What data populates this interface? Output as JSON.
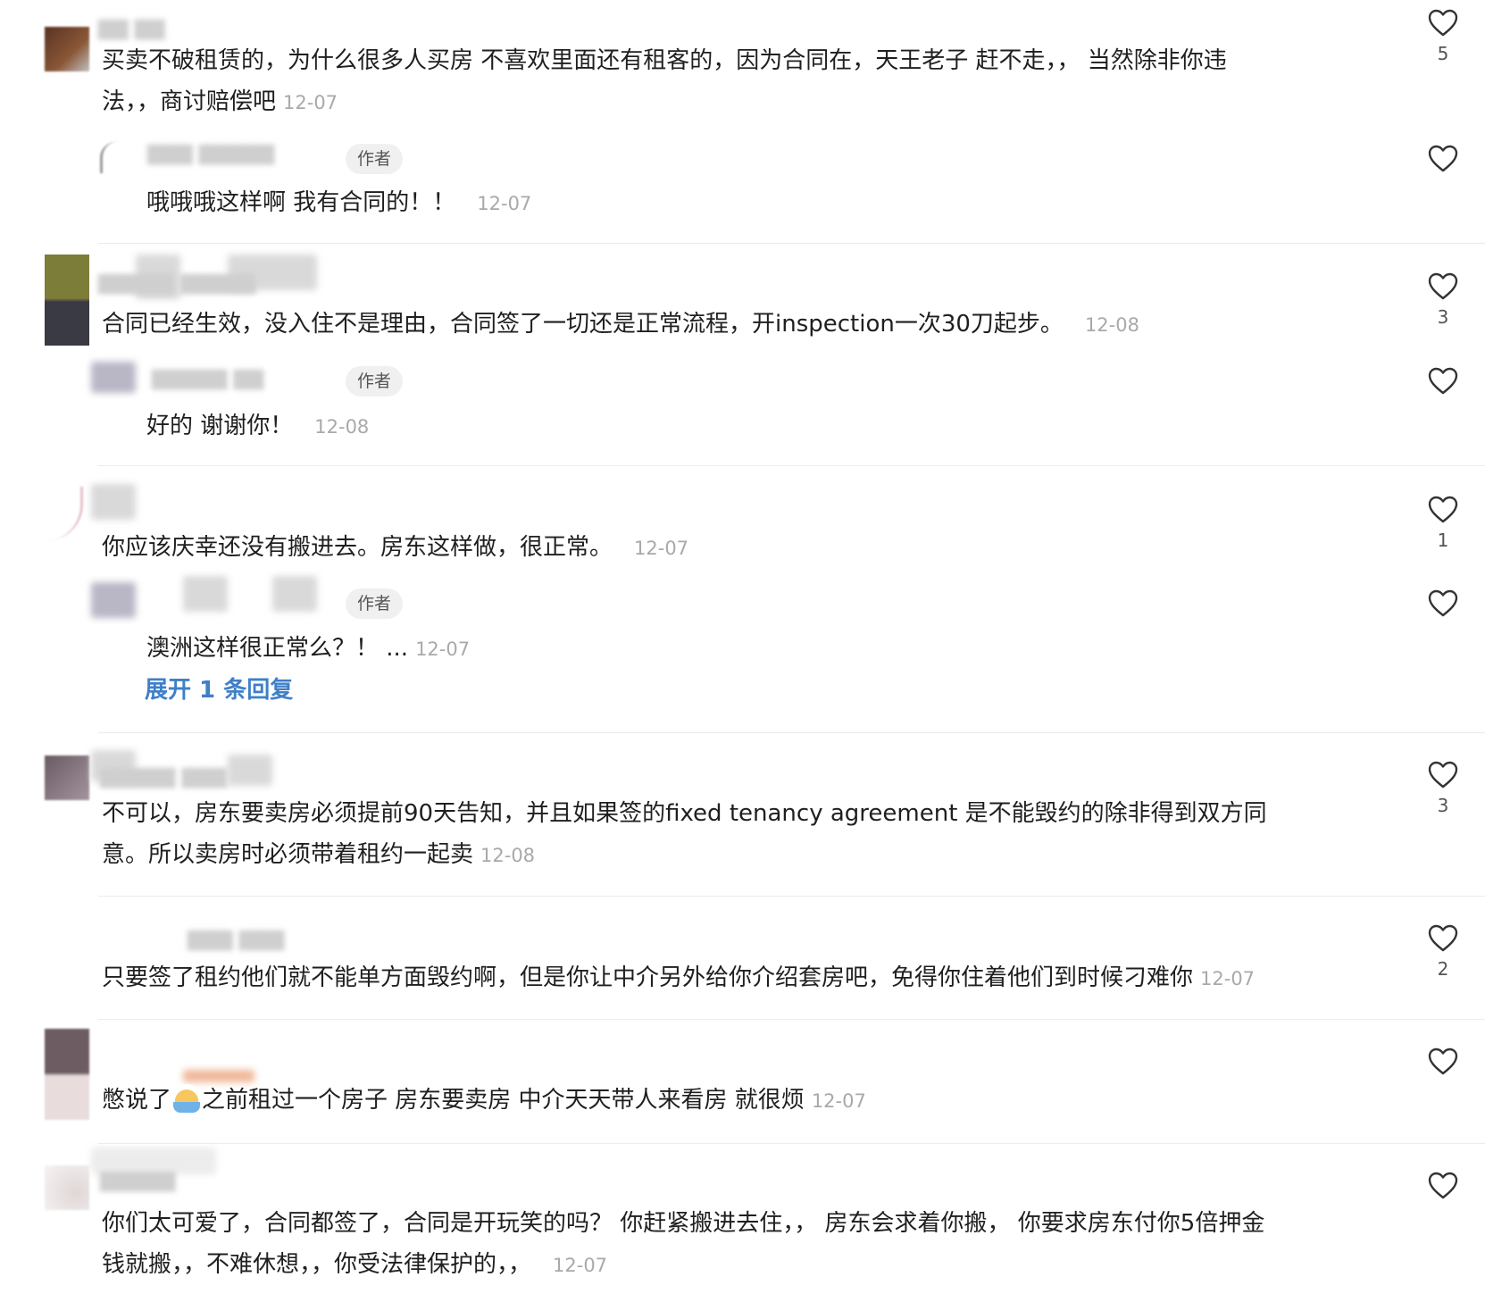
{
  "labels": {
    "author": "作者",
    "expand_replies": "展开 1 条回复"
  },
  "comments": [
    {
      "text_line1": "买卖不破租赁的，为什么很多人买房 不喜欢里面还有租客的，因为合同在，天王老子 赶不走，， 当然除非你违",
      "text_line2": "法，，商讨赔偿吧",
      "date": "12-07",
      "likes": "5",
      "reply": {
        "text": "哦哦哦这样啊 我有合同的！！",
        "date": "12-07"
      }
    },
    {
      "text_line1": "合同已经生效，没入住不是理由，合同签了一切还是正常流程，开inspection一次30刀起步。",
      "date": "12-08",
      "likes": "3",
      "reply": {
        "text": "好的 谢谢你！",
        "date": "12-08"
      }
    },
    {
      "text_line1": "你应该庆幸还没有搬进去。房东这样做，很正常。",
      "date": "12-07",
      "likes": "1",
      "reply": {
        "text": "澳洲这样很正常么？！ ...",
        "date": "12-07"
      }
    },
    {
      "text_line1": "不可以，房东要卖房必须提前90天告知，并且如果签的fixed tenancy agreement 是不能毁约的除非得到双方同",
      "text_line2": "意。所以卖房时必须带着租约一起卖",
      "date": "12-08",
      "likes": "3"
    },
    {
      "text_line1": "只要签了租约他们就不能单方面毁约啊，但是你让中介另外给你介绍套房吧，免得你住着他们到时候刁难你",
      "date": "12-07",
      "likes": "2"
    },
    {
      "text_before_emoji": "憋说了",
      "emoji": "crying-emoji",
      "text_after_emoji": "之前租过一个房子 房东要卖房 中介天天带人来看房 就很烦",
      "date": "12-07"
    },
    {
      "text_line1": "你们太可爱了，合同都签了，合同是开玩笑的吗？ 你赶紧搬进去住，， 房东会求着你搬， 你要求房东付你5倍押金",
      "text_line2": "钱就搬，，不难休想，，你受法律保护的，，",
      "date": "12-07"
    }
  ],
  "colors": {
    "link": "#3f7fc8",
    "date": "#a9a9a9",
    "heart_stroke": "#333333"
  }
}
